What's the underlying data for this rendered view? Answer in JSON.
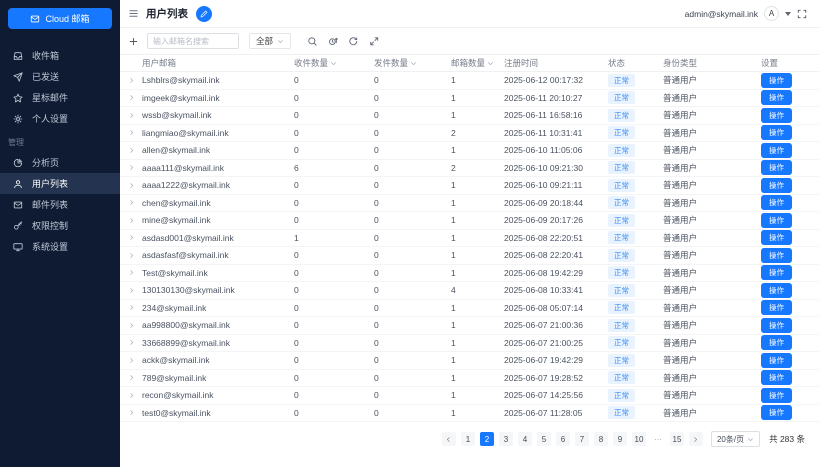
{
  "brand": {
    "label": "Cloud 邮箱",
    "icon": "mail-icon"
  },
  "sidebar": {
    "items": [
      {
        "label": "收件箱",
        "icon": "inbox-icon"
      },
      {
        "label": "已发送",
        "icon": "send-icon"
      },
      {
        "label": "星标邮件",
        "icon": "star-icon"
      },
      {
        "label": "个人设置",
        "icon": "gear-icon"
      }
    ],
    "section_label": "管理",
    "admin_items": [
      {
        "label": "分析页",
        "icon": "pie-chart-icon"
      },
      {
        "label": "用户列表",
        "icon": "user-icon",
        "active": true
      },
      {
        "label": "邮件列表",
        "icon": "mail-list-icon"
      },
      {
        "label": "权限控制",
        "icon": "key-icon"
      },
      {
        "label": "系统设置",
        "icon": "monitor-icon"
      }
    ]
  },
  "header": {
    "title": "用户列表",
    "account_email": "admin@skymail.ink",
    "avatar_letter": "A"
  },
  "toolbar": {
    "search_placeholder": "输入邮箱名搜索",
    "filter_value": "全部"
  },
  "table": {
    "columns": [
      {
        "label": "用户邮箱"
      },
      {
        "label": "收件数量",
        "sortable": true
      },
      {
        "label": "发件数量",
        "sortable": true
      },
      {
        "label": "邮箱数量",
        "sortable": true
      },
      {
        "label": "注册时间"
      },
      {
        "label": "状态"
      },
      {
        "label": "身份类型"
      },
      {
        "label": "设置"
      }
    ],
    "rows": [
      {
        "email": "Lshblrs@skymail.ink",
        "received": 0,
        "sent": 0,
        "mailboxes": 1,
        "registered": "2025-06-12 00:17:32",
        "status": "正常",
        "role": "普通用户",
        "action": "操作"
      },
      {
        "email": "imgeek@skymail.ink",
        "received": 0,
        "sent": 0,
        "mailboxes": 1,
        "registered": "2025-06-11 20:10:27",
        "status": "正常",
        "role": "普通用户",
        "action": "操作"
      },
      {
        "email": "wssb@skymail.ink",
        "received": 0,
        "sent": 0,
        "mailboxes": 1,
        "registered": "2025-06-11 16:58:16",
        "status": "正常",
        "role": "普通用户",
        "action": "操作"
      },
      {
        "email": "liangmiao@skymail.ink",
        "received": 0,
        "sent": 0,
        "mailboxes": 2,
        "registered": "2025-06-11 10:31:41",
        "status": "正常",
        "role": "普通用户",
        "action": "操作"
      },
      {
        "email": "allen@skymail.ink",
        "received": 0,
        "sent": 0,
        "mailboxes": 1,
        "registered": "2025-06-10 11:05:06",
        "status": "正常",
        "role": "普通用户",
        "action": "操作"
      },
      {
        "email": "aaaa111@skymail.ink",
        "received": 6,
        "sent": 0,
        "mailboxes": 2,
        "registered": "2025-06-10 09:21:30",
        "status": "正常",
        "role": "普通用户",
        "action": "操作"
      },
      {
        "email": "aaaa1222@skymail.ink",
        "received": 0,
        "sent": 0,
        "mailboxes": 1,
        "registered": "2025-06-10 09:21:11",
        "status": "正常",
        "role": "普通用户",
        "action": "操作"
      },
      {
        "email": "chen@skymail.ink",
        "received": 0,
        "sent": 0,
        "mailboxes": 1,
        "registered": "2025-06-09 20:18:44",
        "status": "正常",
        "role": "普通用户",
        "action": "操作"
      },
      {
        "email": "mine@skymail.ink",
        "received": 0,
        "sent": 0,
        "mailboxes": 1,
        "registered": "2025-06-09 20:17:26",
        "status": "正常",
        "role": "普通用户",
        "action": "操作"
      },
      {
        "email": "asdasd001@skymail.ink",
        "received": 1,
        "sent": 0,
        "mailboxes": 1,
        "registered": "2025-06-08 22:20:51",
        "status": "正常",
        "role": "普通用户",
        "action": "操作"
      },
      {
        "email": "asdasfasf@skymail.ink",
        "received": 0,
        "sent": 0,
        "mailboxes": 1,
        "registered": "2025-06-08 22:20:41",
        "status": "正常",
        "role": "普通用户",
        "action": "操作"
      },
      {
        "email": "Test@skymail.ink",
        "received": 0,
        "sent": 0,
        "mailboxes": 1,
        "registered": "2025-06-08 19:42:29",
        "status": "正常",
        "role": "普通用户",
        "action": "操作"
      },
      {
        "email": "130130130@skymail.ink",
        "received": 0,
        "sent": 0,
        "mailboxes": 4,
        "registered": "2025-06-08 10:33:41",
        "status": "正常",
        "role": "普通用户",
        "action": "操作"
      },
      {
        "email": "234@skymail.ink",
        "received": 0,
        "sent": 0,
        "mailboxes": 1,
        "registered": "2025-06-08 05:07:14",
        "status": "正常",
        "role": "普通用户",
        "action": "操作"
      },
      {
        "email": "aa998800@skymail.ink",
        "received": 0,
        "sent": 0,
        "mailboxes": 1,
        "registered": "2025-06-07 21:00:36",
        "status": "正常",
        "role": "普通用户",
        "action": "操作"
      },
      {
        "email": "33668899@skymail.ink",
        "received": 0,
        "sent": 0,
        "mailboxes": 1,
        "registered": "2025-06-07 21:00:25",
        "status": "正常",
        "role": "普通用户",
        "action": "操作"
      },
      {
        "email": "ackk@skymail.ink",
        "received": 0,
        "sent": 0,
        "mailboxes": 1,
        "registered": "2025-06-07 19:42:29",
        "status": "正常",
        "role": "普通用户",
        "action": "操作"
      },
      {
        "email": "789@skymail.ink",
        "received": 0,
        "sent": 0,
        "mailboxes": 1,
        "registered": "2025-06-07 19:28:52",
        "status": "正常",
        "role": "普通用户",
        "action": "操作"
      },
      {
        "email": "recon@skymail.ink",
        "received": 0,
        "sent": 0,
        "mailboxes": 1,
        "registered": "2025-06-07 14:25:56",
        "status": "正常",
        "role": "普通用户",
        "action": "操作"
      },
      {
        "email": "test0@skymail.ink",
        "received": 0,
        "sent": 0,
        "mailboxes": 1,
        "registered": "2025-06-07 11:28:05",
        "status": "正常",
        "role": "普通用户",
        "action": "操作"
      }
    ]
  },
  "pagination": {
    "pages": [
      {
        "label": "1"
      },
      {
        "label": "2",
        "active": true
      },
      {
        "label": "3"
      },
      {
        "label": "4"
      },
      {
        "label": "5"
      },
      {
        "label": "6"
      },
      {
        "label": "7"
      },
      {
        "label": "8"
      },
      {
        "label": "9"
      },
      {
        "label": "10"
      },
      {
        "label": "···",
        "type": "ellipsis"
      },
      {
        "label": "15"
      }
    ],
    "page_size": "20条/页",
    "total": "共 283 条"
  },
  "colors": {
    "accent": "#1677ff",
    "sidebar_bg": "#0e1b33",
    "badge_bg": "#e8f3ff",
    "badge_text": "#3d8df5"
  }
}
